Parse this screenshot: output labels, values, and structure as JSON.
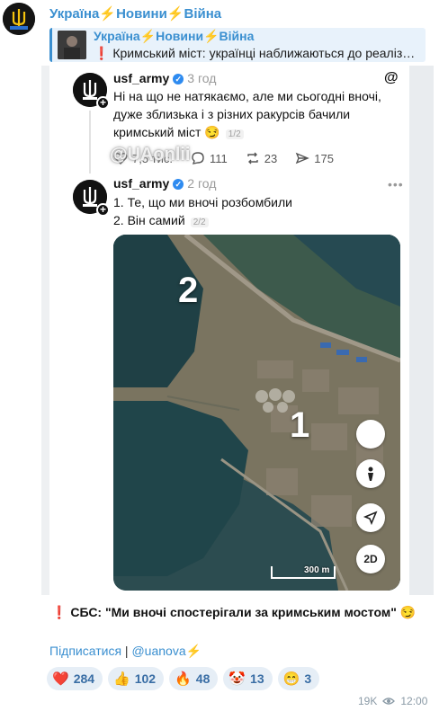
{
  "channel": {
    "name_parts": [
      "Україна",
      "Новини",
      "Війна"
    ]
  },
  "reply": {
    "title_parts": [
      "Україна",
      "Новини",
      "Війна"
    ],
    "text_mark": "❗",
    "text": "Кримський міст: українці наближаються до реаліз…"
  },
  "screenshot": {
    "threads_logo": "@",
    "watermark": "@UAonlii",
    "post1": {
      "user": "usf_army",
      "time": "3 год",
      "text_line1": "Ні на що не натякаємо, але ми сьогодні вночі,",
      "text_line2": "дуже зблизька і з різних ракурсів бачили",
      "text_line3": "кримський міст 😏",
      "counter": "1/2",
      "stats": {
        "likes": "7,5 тис.",
        "comments": "111",
        "reposts": "23",
        "shares": "175"
      }
    },
    "post2": {
      "user": "usf_army",
      "time": "2 год",
      "more": "•••",
      "line1": "1. Те, що ми вночі розбомбили",
      "line2": "2. Він самий",
      "counter": "2/2"
    },
    "map": {
      "label_1": "1",
      "label_2": "2",
      "btn_3d": "2D",
      "scale": "300 m"
    }
  },
  "caption": {
    "mark": "❗",
    "text": "СБС: \"Ми вночі спостерігали за кримським мостом\" 😏"
  },
  "links": {
    "subscribe": "Підписатися",
    "separator": " | ",
    "handle": "@uanova",
    "bolt": "⚡"
  },
  "reactions": [
    {
      "emoji": "❤️",
      "icon": "heart-icon",
      "count": "284"
    },
    {
      "emoji": "👍",
      "icon": "thumbs-up-icon",
      "count": "102"
    },
    {
      "emoji": "🔥",
      "icon": "fire-icon",
      "count": "48"
    },
    {
      "emoji": "🤡",
      "icon": "clown-icon",
      "count": "13"
    },
    {
      "emoji": "😁",
      "icon": "grin-icon",
      "count": "3"
    }
  ],
  "footer": {
    "views": "19K",
    "time": "12:00"
  },
  "colors": {
    "link": "#3a8fd0",
    "reaction_bg": "#e6eef6",
    "bolt": "#f4c20d",
    "alert": "#d9262e"
  }
}
